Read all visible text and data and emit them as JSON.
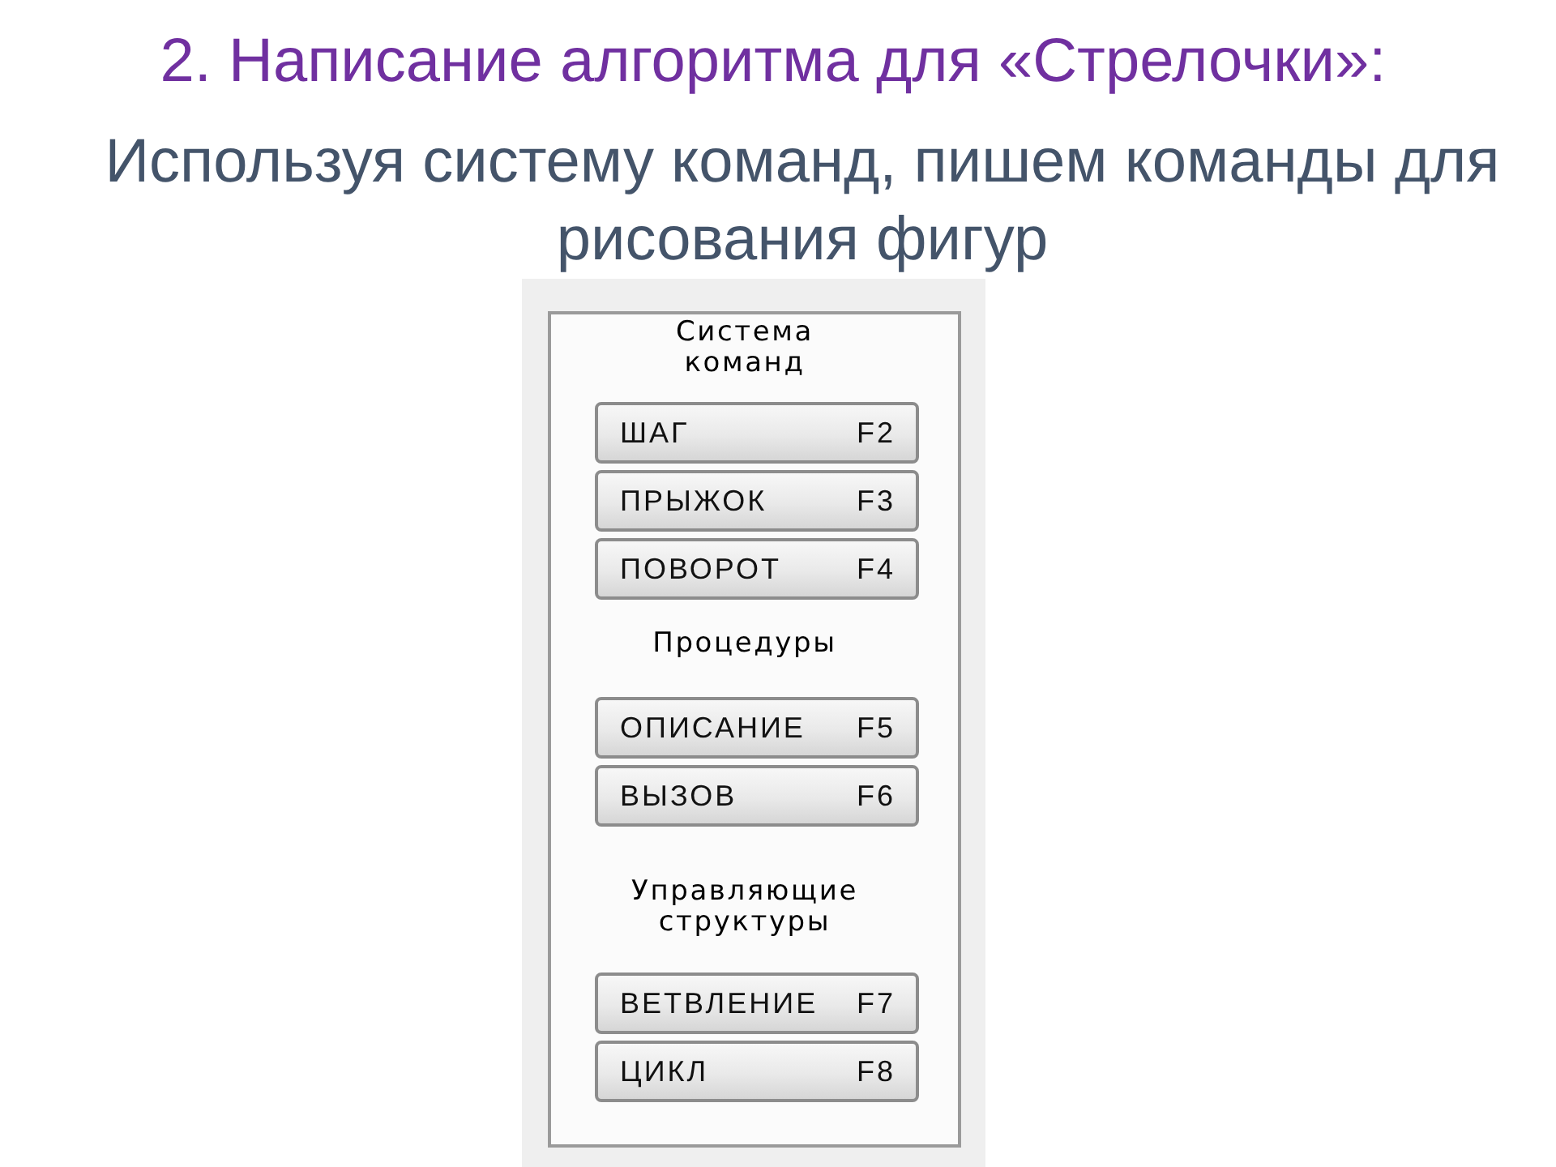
{
  "slide": {
    "title": "2. Написание алгоритма для «Стрелочки»:",
    "subtitle": "Используя систему команд, пишем команды для рисования фигур"
  },
  "panel": {
    "sections": [
      {
        "heading": "Система команд",
        "buttons": [
          {
            "label": "ШАГ",
            "key": "F2"
          },
          {
            "label": "ПРЫЖОК",
            "key": "F3"
          },
          {
            "label": "ПОВОРОТ",
            "key": "F4"
          }
        ]
      },
      {
        "heading": "Процедуры",
        "buttons": [
          {
            "label": "ОПИСАНИЕ",
            "key": "F5"
          },
          {
            "label": "ВЫЗОВ",
            "key": "F6"
          }
        ]
      },
      {
        "heading": "Управляющие структуры",
        "buttons": [
          {
            "label": "ВЕТВЛЕНИЕ",
            "key": "F7"
          },
          {
            "label": "ЦИКЛ",
            "key": "F8"
          }
        ]
      }
    ]
  }
}
